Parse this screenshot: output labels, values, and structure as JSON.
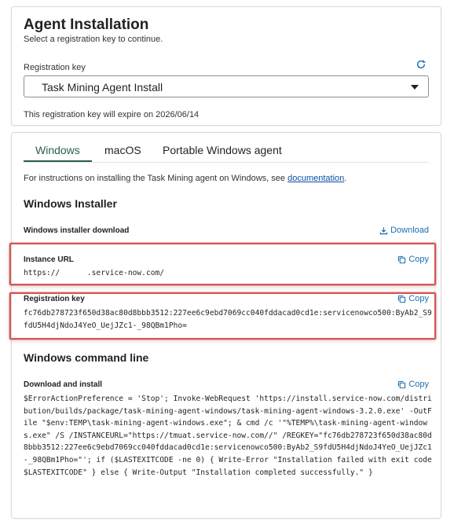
{
  "installation": {
    "title": "Agent Installation",
    "subtitle": "Select a registration key to continue.",
    "registration_key_label": "Registration key",
    "selected_key": "Task Mining Agent Install",
    "expiry_text": "This registration key will expire on 2026/06/14"
  },
  "tabs": [
    {
      "label": "Windows",
      "active": true
    },
    {
      "label": "macOS",
      "active": false
    },
    {
      "label": "Portable Windows agent",
      "active": false
    }
  ],
  "windows": {
    "intro_text": "For instructions on installing the Task Mining agent on Windows, see ",
    "intro_link": "documentation",
    "intro_end": ".",
    "installer_heading": "Windows Installer",
    "installer_download_label": "Windows installer download",
    "download_label": "Download",
    "instance_url_label": "Instance URL",
    "instance_url_value": "https://      .service-now.com/",
    "registration_key_label": "Registration key",
    "registration_key_value": "fc76db278723f650d38ac80d8bbb3512:227ee6c9ebd7069cc040fddacad0cd1e:servicenowco500:ByAb2_S9fdU5H4djNdoJ4YeO_UejJZc1-_98QBm1Pho=",
    "copy_label": "Copy",
    "cmdline_heading": "Windows command line",
    "download_install_label": "Download and install",
    "cmdline_value": "$ErrorActionPreference = 'Stop'; Invoke-WebRequest 'https://install.service-now.com/distribution/builds/package/task-mining-agent-windows/task-mining-agent-windows-3.2.0.exe' -OutFile \"$env:TEMP\\task-mining-agent-windows.exe\"; & cmd /c '\"%TEMP%\\task-mining-agent-windows.exe\" /S /INSTANCEURL=\"https://tmuat.service-now.com//\" /REGKEY=\"fc76db278723f650d38ac80d8bbb3512:227ee6c9ebd7069cc040fddacad0cd1e:servicenowco500:ByAb2_S9fdU5H4djNdoJ4YeO_UejJZc1-_98QBm1Pho=\"'; if ($LASTEXITCODE -ne 0) { Write-Error \"Installation failed with exit code $LASTEXITCODE\" } else { Write-Output \"Installation completed successfully.\" }"
  },
  "colors": {
    "accent_green": "#2c5f4a",
    "link_blue": "#0a4fa3",
    "action_blue": "#1a6fb0",
    "highlight_red": "#d9534f"
  },
  "icons": {
    "refresh": "refresh-icon",
    "dropdown": "chevron-down-icon",
    "download": "download-icon",
    "copy": "copy-icon"
  }
}
